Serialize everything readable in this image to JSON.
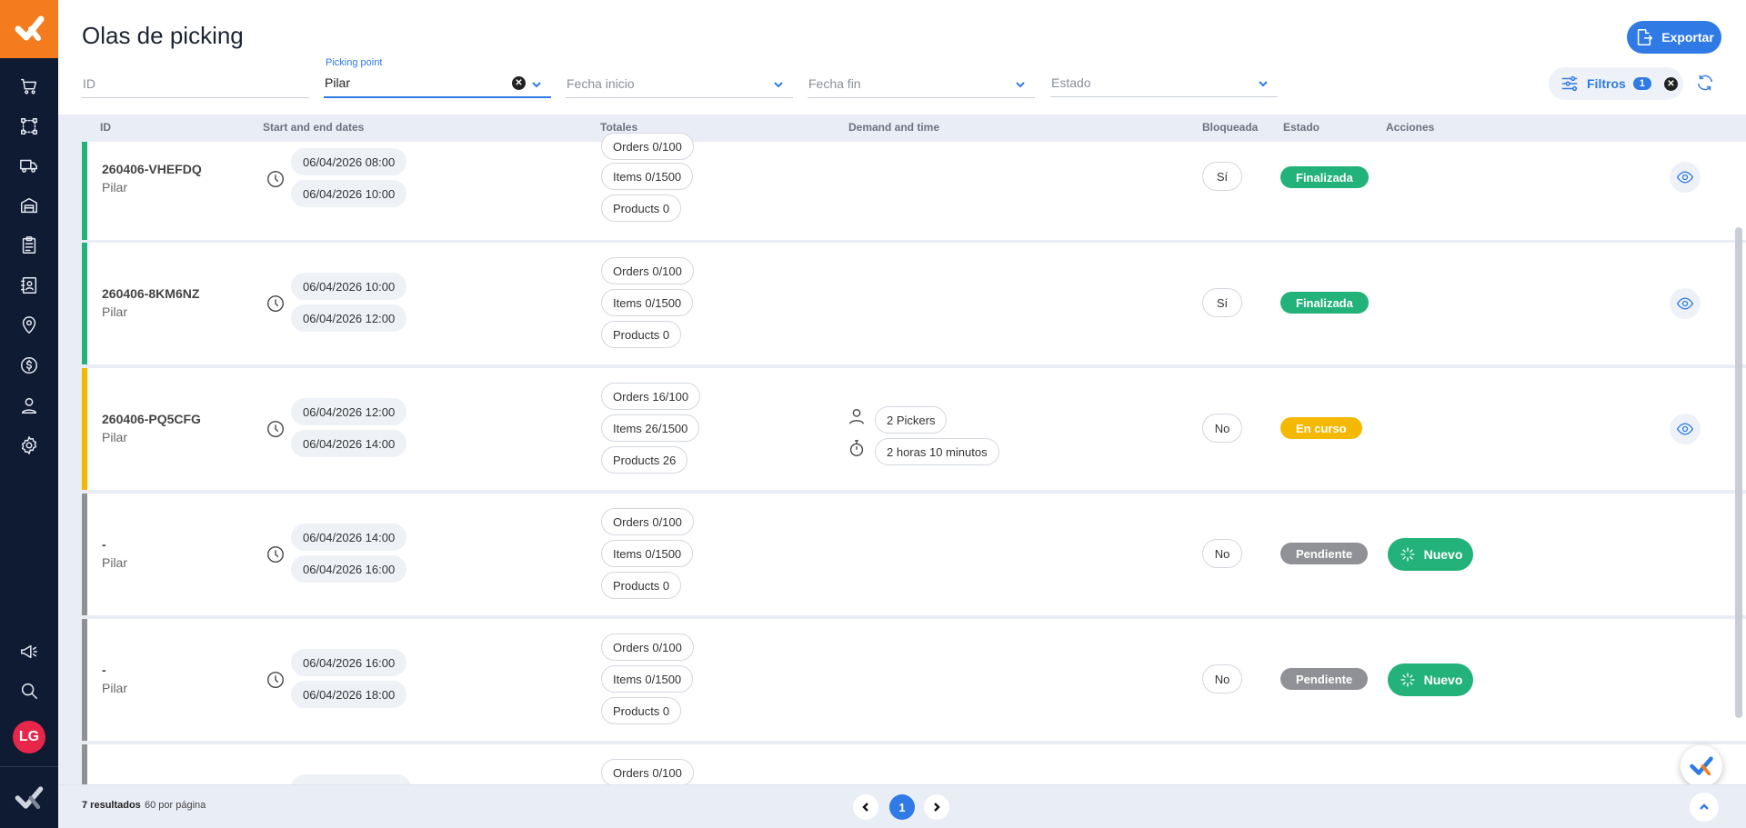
{
  "header": {
    "title": "Olas de picking",
    "export_label": "Exportar"
  },
  "filters": {
    "id_placeholder": "ID",
    "picking_point_label": "Picking point",
    "picking_point_value": "Pilar",
    "fecha_inicio_placeholder": "Fecha inicio",
    "fecha_fin_placeholder": "Fecha fin",
    "estado_placeholder": "Estado",
    "filtros_label": "Filtros",
    "filtros_count": "1"
  },
  "sidebar": {
    "avatar_initials": "LG",
    "items": [
      "cart-icon",
      "route-icon",
      "truck-icon",
      "warehouse-icon",
      "clipboard-icon",
      "contacts-icon",
      "location-icon",
      "dollar-icon",
      "user-icon",
      "settings-icon",
      "megaphone-icon",
      "search-icon"
    ]
  },
  "table": {
    "columns": [
      "ID",
      "Start and end dates",
      "Totales",
      "Demand and time",
      "Bloqueada",
      "Estado",
      "Acciones"
    ],
    "rows": [
      {
        "id": "260406-VHEFDQ",
        "point": "Pilar",
        "start": "06/04/2026 08:00",
        "end": "06/04/2026 10:00",
        "orders": "Orders 0/100",
        "items": "Items 0/1500",
        "products": "Products 0",
        "bloqueada": "Sí",
        "estado": "Finalizada"
      },
      {
        "id": "260406-8KM6NZ",
        "point": "Pilar",
        "start": "06/04/2026 10:00",
        "end": "06/04/2026 12:00",
        "orders": "Orders 0/100",
        "items": "Items 0/1500",
        "products": "Products 0",
        "bloqueada": "Sí",
        "estado": "Finalizada"
      },
      {
        "id": "260406-PQ5CFG",
        "point": "Pilar",
        "start": "06/04/2026 12:00",
        "end": "06/04/2026 14:00",
        "orders": "Orders 16/100",
        "items": "Items 26/1500",
        "products": "Products 26",
        "pickers": "2 Pickers",
        "time": "2 horas 10 minutos",
        "bloqueada": "No",
        "estado": "En curso"
      },
      {
        "id": "-",
        "point": "Pilar",
        "start": "06/04/2026 14:00",
        "end": "06/04/2026 16:00",
        "orders": "Orders 0/100",
        "items": "Items 0/1500",
        "products": "Products 0",
        "bloqueada": "No",
        "estado": "Pendiente",
        "action": "Nuevo"
      },
      {
        "id": "-",
        "point": "Pilar",
        "start": "06/04/2026 16:00",
        "end": "06/04/2026 18:00",
        "orders": "Orders 0/100",
        "items": "Items 0/1500",
        "products": "Products 0",
        "bloqueada": "No",
        "estado": "Pendiente",
        "action": "Nuevo"
      },
      {
        "orders": "Orders 0/100"
      }
    ]
  },
  "footer": {
    "results": "7 resultados",
    "per_page": "60 por página",
    "current_page": "1"
  },
  "colors": {
    "accent": "#2f7ae5",
    "finalizada": "#22b27a",
    "en_curso": "#f5b800",
    "pendiente": "#8f9196",
    "sidebar": "#0f1b33",
    "logo_bg": "#f47c1f"
  }
}
